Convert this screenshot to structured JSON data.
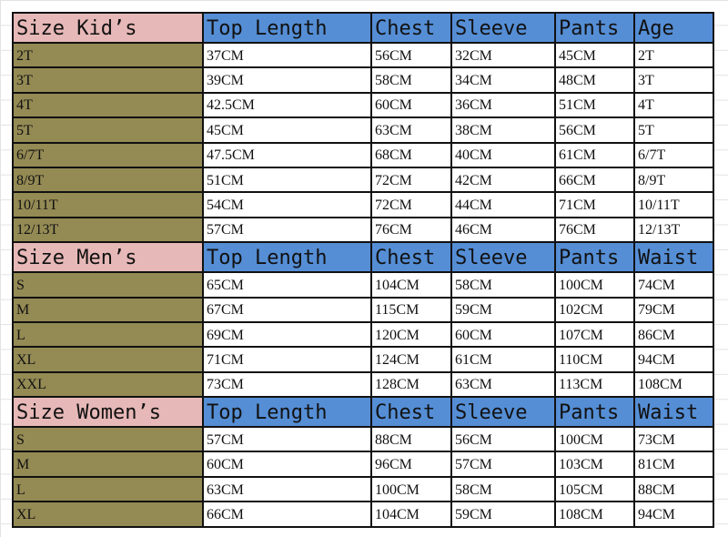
{
  "colors": {
    "section_header": "#e6b8b7",
    "column_header": "#558ed5",
    "size_cell": "#948a54"
  },
  "sections": [
    {
      "title": "Size Kid’s",
      "columns": [
        "Top Length",
        "Chest",
        "Sleeve",
        "Pants",
        "Age"
      ],
      "rows": [
        [
          "2T",
          "37CM",
          "56CM",
          "32CM",
          "45CM",
          "2T"
        ],
        [
          "3T",
          "39CM",
          "58CM",
          "34CM",
          "48CM",
          "3T"
        ],
        [
          "4T",
          "42.5CM",
          "60CM",
          "36CM",
          "51CM",
          "4T"
        ],
        [
          "5T",
          "45CM",
          "63CM",
          "38CM",
          "56CM",
          "5T"
        ],
        [
          "6/7T",
          "47.5CM",
          "68CM",
          "40CM",
          "61CM",
          "6/7T"
        ],
        [
          "8/9T",
          "51CM",
          "72CM",
          "42CM",
          "66CM",
          "8/9T"
        ],
        [
          "10/11T",
          "54CM",
          "72CM",
          "44CM",
          "71CM",
          "10/11T"
        ],
        [
          "12/13T",
          "57CM",
          "76CM",
          "46CM",
          "76CM",
          "12/13T"
        ]
      ]
    },
    {
      "title": "Size Men’s",
      "columns": [
        "Top Length",
        "Chest",
        "Sleeve",
        "Pants",
        "Waist"
      ],
      "rows": [
        [
          "S",
          "65CM",
          "104CM",
          "58CM",
          "100CM",
          "74CM"
        ],
        [
          "M",
          "67CM",
          "115CM",
          "59CM",
          "102CM",
          "79CM"
        ],
        [
          "L",
          "69CM",
          "120CM",
          "60CM",
          "107CM",
          "86CM"
        ],
        [
          "XL",
          "71CM",
          "124CM",
          "61CM",
          "110CM",
          "94CM"
        ],
        [
          "XXL",
          "73CM",
          "128CM",
          "63CM",
          "113CM",
          "108CM"
        ]
      ]
    },
    {
      "title": "Size Women’s",
      "columns": [
        "Top Length",
        "Chest",
        "Sleeve",
        "Pants",
        "Waist"
      ],
      "rows": [
        [
          "S",
          "57CM",
          "88CM",
          "56CM",
          "100CM",
          "73CM"
        ],
        [
          "M",
          "60CM",
          "96CM",
          "57CM",
          "103CM",
          "81CM"
        ],
        [
          "L",
          "63CM",
          "100CM",
          "58CM",
          "105CM",
          "88CM"
        ],
        [
          "XL",
          "66CM",
          "104CM",
          "59CM",
          "108CM",
          "94CM"
        ]
      ]
    }
  ]
}
